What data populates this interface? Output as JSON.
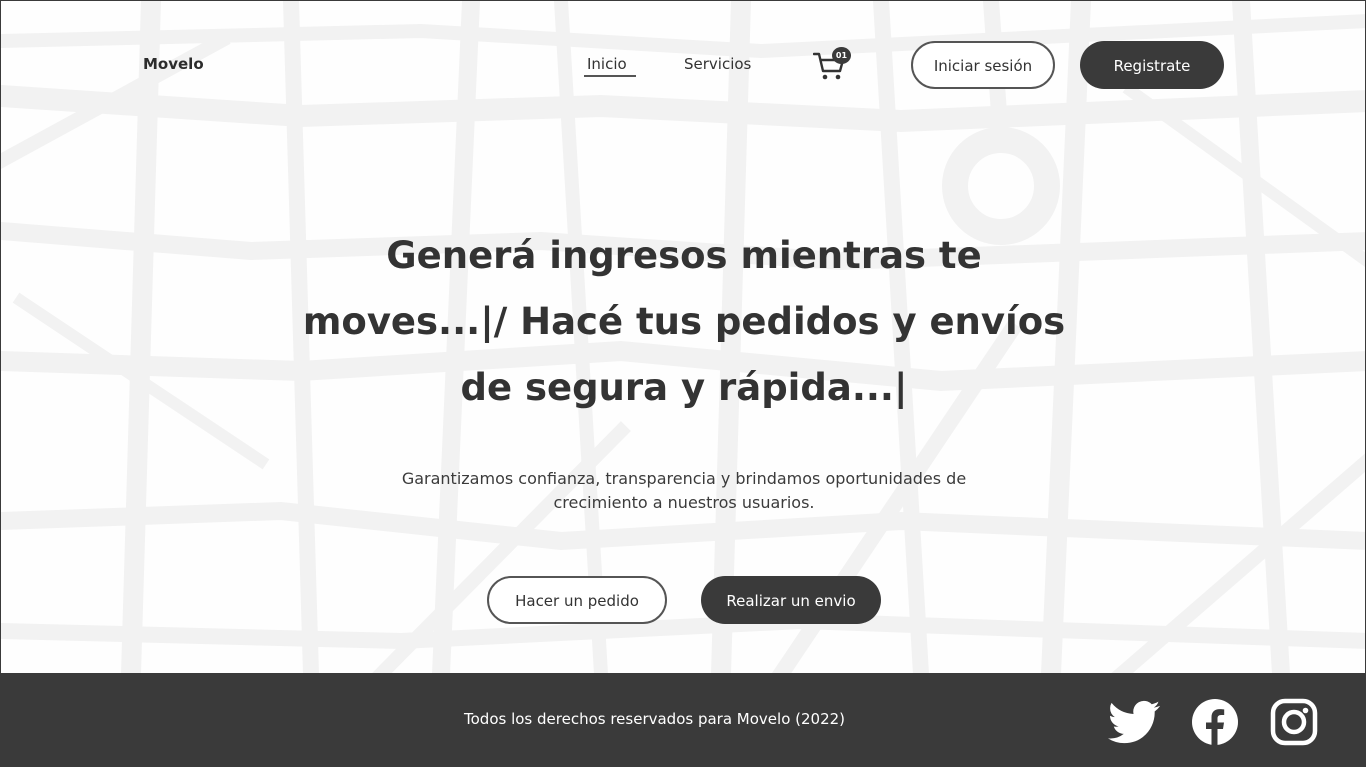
{
  "header": {
    "brand": "Movelo",
    "nav": {
      "home": "Inicio",
      "services": "Servicios"
    },
    "cart": {
      "icon": "cart-icon",
      "badge": "01"
    },
    "login_label": "Iniciar sesión",
    "register_label": "Registrate"
  },
  "hero": {
    "title": "Generá ingresos mientras te moves...|/ Hacé tus pedidos y envíos de segura y rápida...|",
    "subtitle": "Garantizamos confianza, transparencia y brindamos oportunidades de crecimiento a nuestros usuarios.",
    "order_label": "Hacer un pedido",
    "ship_label": "Realizar un envio"
  },
  "footer": {
    "copyright": "Todos los derechos reservados para Movelo (2022)",
    "social": [
      "twitter-icon",
      "facebook-icon",
      "instagram-icon"
    ]
  },
  "colors": {
    "dark": "#3a3a3a",
    "map_lines": "#f1f1f1",
    "background": "#fefefe"
  }
}
